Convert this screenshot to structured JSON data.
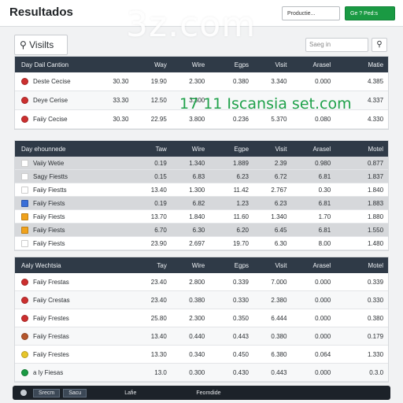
{
  "header": {
    "title": "Resultados",
    "product_button": "Prоductie...",
    "new_button": "Ge ? Ped:s",
    "watermark": "3z.com"
  },
  "toolbar": {
    "tab_label": "Visilts",
    "search_placeholder": "Saeg in"
  },
  "overlay": "17 11 Iscansia set.com",
  "table1": {
    "headers": [
      "Day Dail Cantion",
      "",
      "Way",
      "Wire",
      "Egps",
      "Visit",
      "Arasel",
      "Matie"
    ],
    "rows": [
      {
        "icon_color": "#cc2f2f",
        "name": "Deste Cecise",
        "v": [
          "30.30",
          "19.90",
          "2.300",
          "0.380",
          "3.340",
          "0.000",
          "4.385"
        ]
      },
      {
        "icon_color": "#cc2f2f",
        "name": "Deye Cerise",
        "v": [
          "33.30",
          "12.50",
          "3.300",
          "",
          "",
          "",
          "4.337"
        ]
      },
      {
        "icon_color": "#cc2f2f",
        "name": "Faiiy Cecise",
        "v": [
          "30.30",
          "22.95",
          "3.800",
          "0.236",
          "5.370",
          "0.080",
          "4.330"
        ]
      }
    ]
  },
  "table2": {
    "headers": [
      "Day ehounnede",
      "",
      "Taw",
      "Wire",
      "Egpe",
      "Visit",
      "Arasel",
      "Motel"
    ],
    "rows": [
      {
        "icon_color": "#ffffff",
        "name": "Vaiiy Wetie",
        "v": [
          "",
          "0.19",
          "1.340",
          "1.889",
          "2.39",
          "0.980",
          "0.877"
        ]
      },
      {
        "icon_color": "#ffffff",
        "name": "Sagy Fiestts",
        "v": [
          "",
          "0.15",
          "6.83",
          "6.23",
          "6.72",
          "6.81",
          "1.837"
        ]
      },
      {
        "icon_color": "#ffffff",
        "name": "Faiiy Fiestts",
        "v": [
          "",
          "13.40",
          "1.300",
          "11.42",
          "2.767",
          "0.30",
          "1.840"
        ]
      },
      {
        "icon_color": "#3a6fd8",
        "name": "Faiiy Fiests",
        "v": [
          "",
          "0.19",
          "6.82",
          "1.23",
          "6.23",
          "6.81",
          "1.883"
        ]
      },
      {
        "icon_color": "#f0a21c",
        "name": "Faiiy Fiests",
        "v": [
          "",
          "13.70",
          "1.840",
          "11.60",
          "1.340",
          "1.70",
          "1.880"
        ]
      },
      {
        "icon_color": "#f0a21c",
        "name": "Faiiy Fiests",
        "v": [
          "",
          "6.70",
          "6.30",
          "6.20",
          "6.45",
          "6.81",
          "1.550"
        ]
      },
      {
        "icon_color": "#ffffff",
        "name": "Faiiy Fiests",
        "v": [
          "",
          "23.90",
          "2.697",
          "19.70",
          "6.30",
          "8.00",
          "1.480"
        ]
      }
    ]
  },
  "table3": {
    "headers": [
      "Aaly Wechtsia",
      "",
      "Tay",
      "Wire",
      "Egps",
      "Visit",
      "Arasel",
      "Motel"
    ],
    "rows": [
      {
        "icon_color": "#cc2f2f",
        "name": "Faiiy Frestas",
        "v": [
          "",
          "23.40",
          "2.800",
          "0.339",
          "7.000",
          "0.000",
          "0.339"
        ]
      },
      {
        "icon_color": "#cc2f2f",
        "name": "Faiiy Crestas",
        "v": [
          "",
          "23.40",
          "0.380",
          "0.330",
          "2.380",
          "0.000",
          "0.330"
        ]
      },
      {
        "icon_color": "#cc2f2f",
        "name": "Faiiy Frestes",
        "v": [
          "",
          "25.80",
          "2.300",
          "0.350",
          "6.444",
          "0.000",
          "0.380"
        ]
      },
      {
        "icon_color": "#b5562c",
        "name": "Faiiy Frestas",
        "v": [
          "",
          "13.40",
          "0.440",
          "0.443",
          "0.380",
          "0.000",
          "0.179"
        ]
      },
      {
        "icon_color": "#e7c62a",
        "name": "Faiiy Frestes",
        "v": [
          "",
          "13.30",
          "0.340",
          "0.450",
          "6.380",
          "0.064",
          "1.330"
        ]
      },
      {
        "icon_color": "#1a9a43",
        "name": "a ly Fiesas",
        "v": [
          "",
          "13.0",
          "0.300",
          "0.430",
          "0.443",
          "0.000",
          "0.3.0"
        ]
      }
    ]
  },
  "footer": {
    "item1": "Srecm",
    "item2": "Sacu",
    "item3": "Lafie",
    "item4": "Feomdide"
  }
}
